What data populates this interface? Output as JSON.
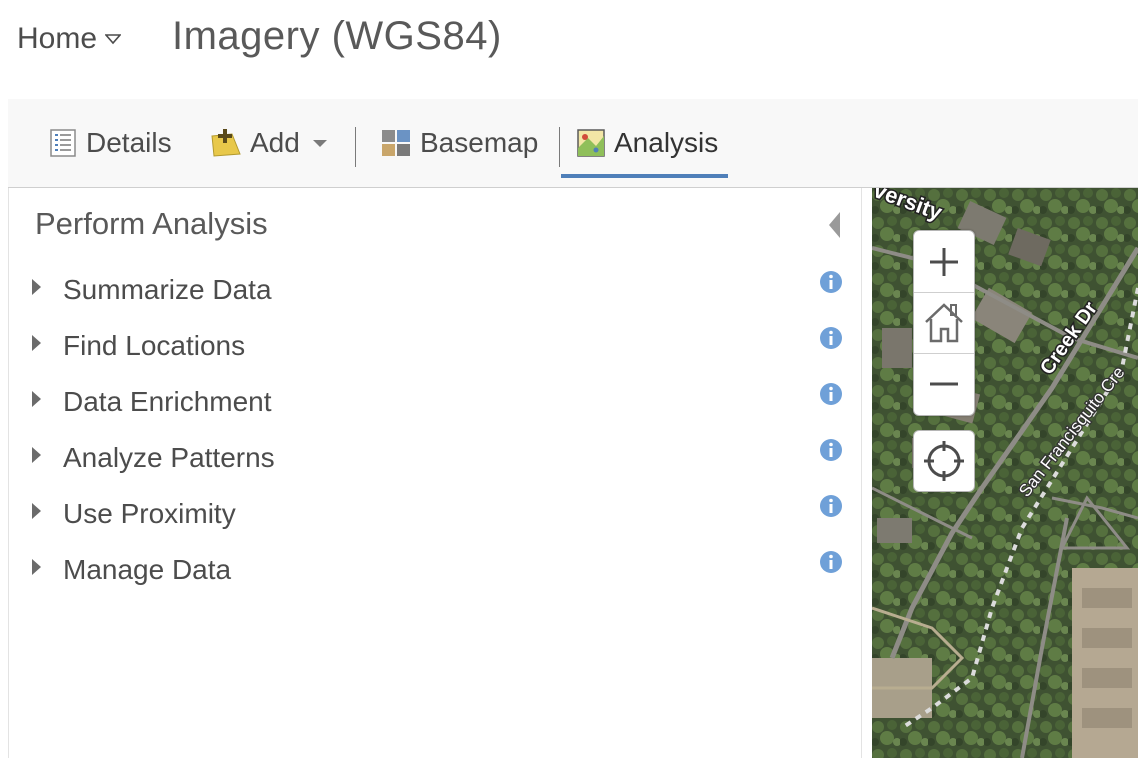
{
  "header": {
    "home_label": "Home",
    "map_title": "Imagery (WGS84)"
  },
  "toolbar": {
    "details_label": "Details",
    "add_label": "Add",
    "basemap_label": "Basemap",
    "analysis_label": "Analysis",
    "active_tab": "Analysis",
    "accent_color": "#4f7fb9"
  },
  "panel": {
    "title": "Perform Analysis",
    "items": [
      {
        "label": "Summarize Data",
        "icon": "info-icon"
      },
      {
        "label": "Find Locations",
        "icon": "info-icon"
      },
      {
        "label": "Data Enrichment",
        "icon": "info-icon"
      },
      {
        "label": "Analyze Patterns",
        "icon": "info-icon"
      },
      {
        "label": "Use Proximity",
        "icon": "info-icon"
      },
      {
        "label": "Manage Data",
        "icon": "info-icon"
      }
    ]
  },
  "map": {
    "street_labels": [
      "Creek Dr",
      "San Francisquito Cre",
      "versity"
    ],
    "controls": [
      "zoom-in-icon",
      "home-icon",
      "zoom-out-icon",
      "locate-icon"
    ]
  }
}
